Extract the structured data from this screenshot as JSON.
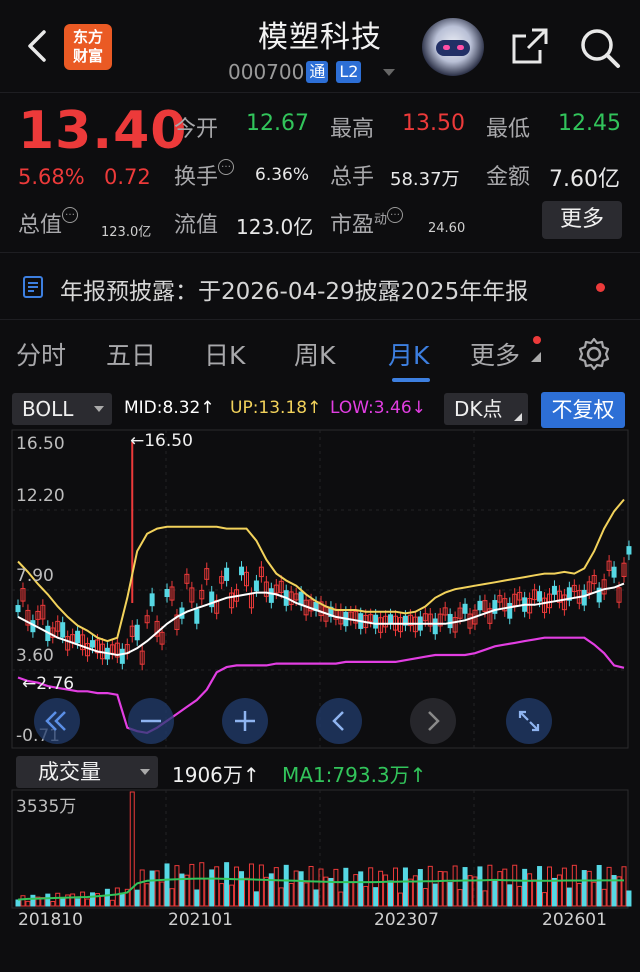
{
  "header": {
    "logo_line1": "东方",
    "logo_line2": "财富",
    "title": "模塑科技",
    "code": "000700",
    "badge_tong": "通",
    "badge_l2": "L2"
  },
  "quote": {
    "price": "13.40",
    "change_pct": "5.68%",
    "change_abs": "0.72",
    "open_label": "今开",
    "open": "12.67",
    "high_label": "最高",
    "high": "13.50",
    "low_label": "最低",
    "low": "12.45",
    "turnover_label": "换手",
    "turnover": "6.36%",
    "volume_label": "总手",
    "volume": "58.37万",
    "amount_label": "金额",
    "amount": "7.60亿",
    "mktcap_label": "总值",
    "mktcap": "123.0亿",
    "float_label": "流值",
    "float_cap": "123.0亿",
    "pe_label": "市盈",
    "pe_sup": "动",
    "pe": "24.60",
    "more_label": "更多"
  },
  "notice": {
    "text": "年报预披露：于2026-04-29披露2025年年报"
  },
  "tabs": {
    "items": [
      "分时",
      "五日",
      "日K",
      "周K",
      "月K",
      "更多"
    ],
    "active": "月K"
  },
  "indicator": {
    "name": "BOLL",
    "mid": "MID:8.32↑",
    "up": "UP:13.18↑",
    "low": "LOW:3.46↓",
    "dk": "DK点",
    "adjust": "不复权",
    "colors": {
      "mid": "#ffffff",
      "up": "#f2d25b",
      "low": "#e23ee2",
      "red": "#ec3a3a",
      "cyan": "#56d8e4"
    }
  },
  "chart_axis": {
    "y_ticks": [
      "16.50",
      "12.20",
      "7.90",
      "3.60",
      "-0.71"
    ],
    "max_note": "←16.50",
    "min_note": "←2.76"
  },
  "volume": {
    "name": "成交量",
    "value": "1906万↑",
    "ma1": "MA1:793.3万↑",
    "y_top": "3535万"
  },
  "x_labels": [
    "201810",
    "202101",
    "202307",
    "202601"
  ],
  "chart_data": {
    "type": "candlestick",
    "title": "",
    "period": "monthly",
    "ylim": [
      -0.71,
      16.5
    ],
    "highest": 16.5,
    "lowest": 2.76,
    "series": [
      {
        "name": "MID",
        "values": [
          6.4,
          6.1,
          5.8,
          5.5,
          5.2,
          5.0,
          4.8,
          4.6,
          4.4,
          4.3,
          4.2,
          4.3,
          4.6,
          5.0,
          5.5,
          6.0,
          6.4,
          6.7,
          6.9,
          7.1,
          7.3,
          7.5,
          7.6,
          7.7,
          7.8,
          7.8,
          7.7,
          7.5,
          7.2,
          7.0,
          6.8,
          6.6,
          6.4,
          6.3,
          6.2,
          6.1,
          6.0,
          6.0,
          6.0,
          6.0,
          6.0,
          6.0,
          6.0,
          6.0,
          6.1,
          6.2,
          6.4,
          6.6,
          6.8,
          6.9,
          7.0,
          7.1,
          7.1,
          7.2,
          7.3,
          7.4,
          7.5,
          7.6,
          7.8,
          8.0,
          8.1,
          8.32
        ]
      },
      {
        "name": "UP",
        "values": [
          9.6,
          9.0,
          8.3,
          7.7,
          7.0,
          6.4,
          5.9,
          5.6,
          5.2,
          5.0,
          5.2,
          7.5,
          10.2,
          11.2,
          11.5,
          11.6,
          11.6,
          11.6,
          11.6,
          11.6,
          11.6,
          11.5,
          11.5,
          11.5,
          10.8,
          9.7,
          8.9,
          8.5,
          8.2,
          7.7,
          7.3,
          7.0,
          6.8,
          6.8,
          6.8,
          6.7,
          6.7,
          6.7,
          6.7,
          6.6,
          6.7,
          7.0,
          7.5,
          7.8,
          8.0,
          8.1,
          8.2,
          8.3,
          8.4,
          8.5,
          8.6,
          8.7,
          8.8,
          8.9,
          8.9,
          9.0,
          8.9,
          9.2,
          10.2,
          11.5,
          12.5,
          13.18
        ]
      },
      {
        "name": "LOW",
        "values": [
          2.9,
          2.7,
          2.6,
          2.4,
          2.3,
          2.2,
          2.1,
          2.1,
          2.0,
          2.0,
          1.9,
          0.0,
          -0.2,
          -0.3,
          0.0,
          0.4,
          0.8,
          1.2,
          1.6,
          2.2,
          3.2,
          3.5,
          3.6,
          3.6,
          3.6,
          3.6,
          3.7,
          3.7,
          3.7,
          3.7,
          3.7,
          3.7,
          3.7,
          3.8,
          3.8,
          3.8,
          3.8,
          3.8,
          3.8,
          3.9,
          4.0,
          4.1,
          4.2,
          4.2,
          4.2,
          4.2,
          4.3,
          4.5,
          4.7,
          4.8,
          4.9,
          5.0,
          5.1,
          5.2,
          5.2,
          5.2,
          5.2,
          5.2,
          4.8,
          4.3,
          3.6,
          3.46
        ]
      }
    ],
    "volume_ma1": [
      200,
      220,
      230,
      240,
      250,
      260,
      270,
      280,
      300,
      330,
      360,
      420,
      700,
      780,
      800,
      820,
      830,
      840,
      850,
      850,
      850,
      840,
      830,
      830,
      820,
      810,
      800,
      790,
      780,
      770,
      760,
      750,
      740,
      740,
      740,
      740,
      740,
      750,
      750,
      760,
      760,
      770,
      770,
      780,
      780,
      790,
      790,
      800,
      810,
      800,
      790,
      780,
      780,
      780,
      780,
      790,
      790,
      790,
      790,
      793.3,
      793.3,
      793.3
    ]
  }
}
